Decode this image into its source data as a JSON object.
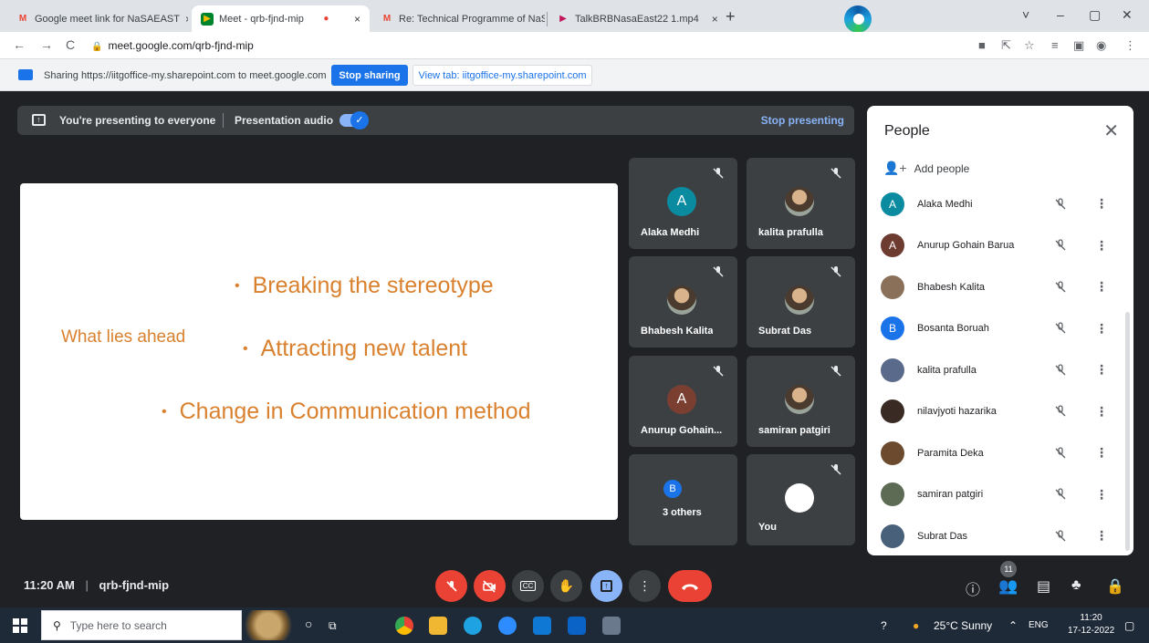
{
  "browser": {
    "tabs": [
      {
        "title": "Google meet link for NaSAEAST",
        "icon": "gmail-icon",
        "close": "×"
      },
      {
        "title": "Meet - qrb-fjnd-mip",
        "icon": "meet-icon",
        "close": "×"
      },
      {
        "title": "Re: Technical Programme of NaS",
        "icon": "gmail-icon",
        "close": "×"
      },
      {
        "title": "TalkBRBNasaEast22 1.mp4",
        "icon": "video-icon",
        "close": "×"
      }
    ],
    "new_tab": "+",
    "url": "meet.google.com/qrb-fjnd-mip",
    "window_controls": [
      "˅",
      "–",
      "▢",
      "✕"
    ]
  },
  "share_bar": {
    "text": "Sharing https://iitgoffice-my.sharepoint.com to meet.google.com",
    "stop_label": "Stop sharing",
    "view_label": "View tab: iitgoffice-my.sharepoint.com"
  },
  "present_bar": {
    "text": "You're presenting to everyone",
    "audio_label": "Presentation audio",
    "audio_on": true,
    "stop_label": "Stop presenting"
  },
  "slide": {
    "lead": "What lies ahead",
    "bullets": [
      "Breaking the stereotype",
      "Attracting new talent",
      "Change in Communication method"
    ],
    "bullet_char": "•",
    "color": "#d9812f"
  },
  "tiles": [
    {
      "name": "Alaka Medhi",
      "initial": "A",
      "color": "#0b8ba0",
      "muted": true
    },
    {
      "name": "kalita prafulla",
      "initial": "",
      "photo": true,
      "muted": true
    },
    {
      "name": "Bhabesh Kalita",
      "initial": "",
      "photo": true,
      "muted": true
    },
    {
      "name": "Subrat Das",
      "initial": "",
      "photo": true,
      "muted": true
    },
    {
      "name": "Anurup Gohain...",
      "initial": "A",
      "color": "#7b3f32",
      "muted": true
    },
    {
      "name": "samiran patgiri",
      "initial": "",
      "photo": true,
      "muted": true
    },
    {
      "name": "3 others",
      "initial": "B",
      "color": "#1a73e8",
      "muted": false
    },
    {
      "name": "You",
      "initial": "",
      "photo": true,
      "muted": true
    }
  ],
  "people_panel": {
    "title": "People",
    "close": "✕",
    "add_label": "Add people",
    "participants": [
      {
        "name": "Alaka Medhi",
        "initial": "A",
        "color": "#0b8ba0"
      },
      {
        "name": "Anurup Gohain Barua",
        "initial": "A",
        "color": "#6d3b30"
      },
      {
        "name": "Bhabesh Kalita",
        "initial": "",
        "color": "#8a7058"
      },
      {
        "name": "Bosanta Boruah",
        "initial": "B",
        "color": "#1a73e8"
      },
      {
        "name": "kalita prafulla",
        "initial": "",
        "color": "#5a6a8a"
      },
      {
        "name": "nilavjyoti hazarika",
        "initial": "",
        "color": "#3a2a24"
      },
      {
        "name": "Paramita Deka",
        "initial": "",
        "color": "#6b4a2e"
      },
      {
        "name": "samiran patgiri",
        "initial": "",
        "color": "#5d6b55"
      },
      {
        "name": "Subrat Das",
        "initial": "",
        "color": "#48607a"
      }
    ],
    "more": "⋮"
  },
  "bottom_bar": {
    "time": "11:20 AM",
    "separator": "|",
    "meeting_code": "qrb-fjnd-mip",
    "participant_count": "11"
  },
  "taskbar": {
    "search_placeholder": "Type here to search",
    "weather": "25°C  Sunny",
    "lang": "ENG",
    "time": "11:20",
    "date": "17-12-2022"
  }
}
